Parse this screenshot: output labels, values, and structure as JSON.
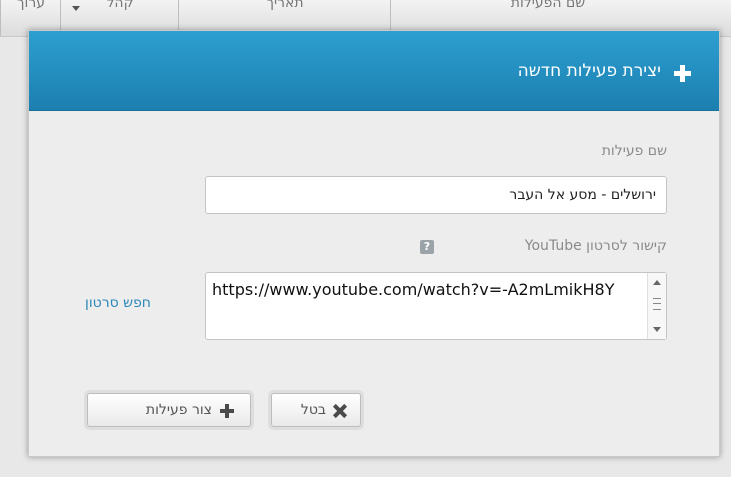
{
  "background_table": {
    "columns": [
      "שם הפעילות",
      "תאריך",
      "קהל",
      "ערוך"
    ]
  },
  "modal": {
    "title": "יצירת פעילות חדשה",
    "activity_name_label": "שם פעילות",
    "activity_name_value": "ירושלים - מסע אל העבר",
    "youtube_label": "קישור לסרטון YouTube",
    "youtube_help": "?",
    "youtube_value": "https://www.youtube.com/watch?v=-A2mLmikH8Y",
    "search_video_link": "חפש סרטון",
    "cancel_label": "בטל",
    "create_label": "צור פעילות"
  }
}
